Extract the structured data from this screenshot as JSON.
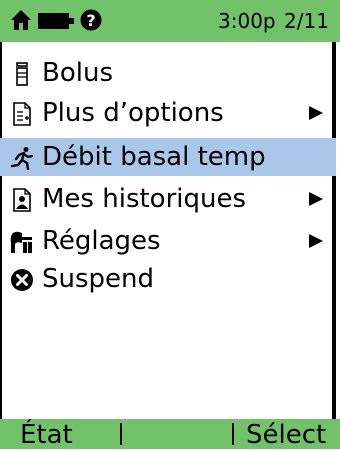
{
  "status": {
    "time": "3:00p",
    "date": "2/11",
    "bar_color": "#72c26a",
    "icons": [
      "home-icon",
      "battery-icon",
      "help-icon"
    ]
  },
  "menu": {
    "items": [
      {
        "label": "Bolus",
        "icon": "vial-icon",
        "has_submenu": false,
        "selected": false
      },
      {
        "label": "Plus d’options",
        "icon": "document-list-icon",
        "has_submenu": true,
        "selected": false
      },
      {
        "label": "Débit basal temp",
        "icon": "running-person-icon",
        "has_submenu": false,
        "selected": true
      },
      {
        "label": "Mes historiques",
        "icon": "document-person-icon",
        "has_submenu": true,
        "selected": false
      },
      {
        "label": "Réglages",
        "icon": "tools-icon",
        "has_submenu": true,
        "selected": false
      },
      {
        "label": "Suspend",
        "icon": "stop-x-icon",
        "has_submenu": false,
        "selected": false
      }
    ],
    "selected_color": "#a9c7e8"
  },
  "softkeys": {
    "left": "État",
    "right": "Sélect"
  }
}
